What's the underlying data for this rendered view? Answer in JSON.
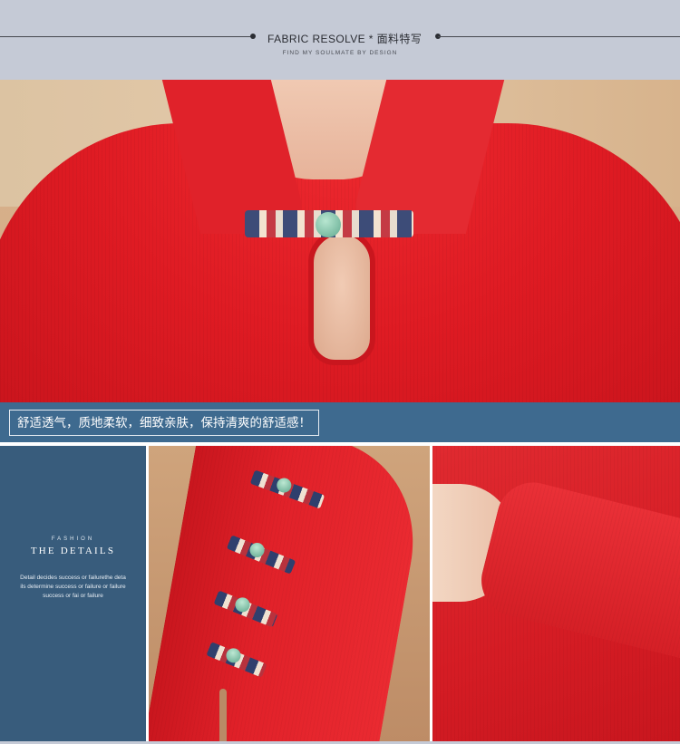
{
  "header": {
    "title": "FABRIC RESOLVE * 面料特写",
    "subtitle": "FIND MY SOULMATE BY DESIGN"
  },
  "caption": {
    "text": "舒适透气，质地柔软，细致亲肤，保持清爽的舒适感！"
  },
  "details": {
    "kicker": "FASHION",
    "heading": "THE DETAILS",
    "body": "Detail decides success or failurethe details determine success or failure or failuresuccess or fai or failure"
  },
  "colors": {
    "header_bg": "#c5cad6",
    "band_bg": "#3e6a8f",
    "details_bg": "#385c7c",
    "garment_red": "#df1b23"
  }
}
